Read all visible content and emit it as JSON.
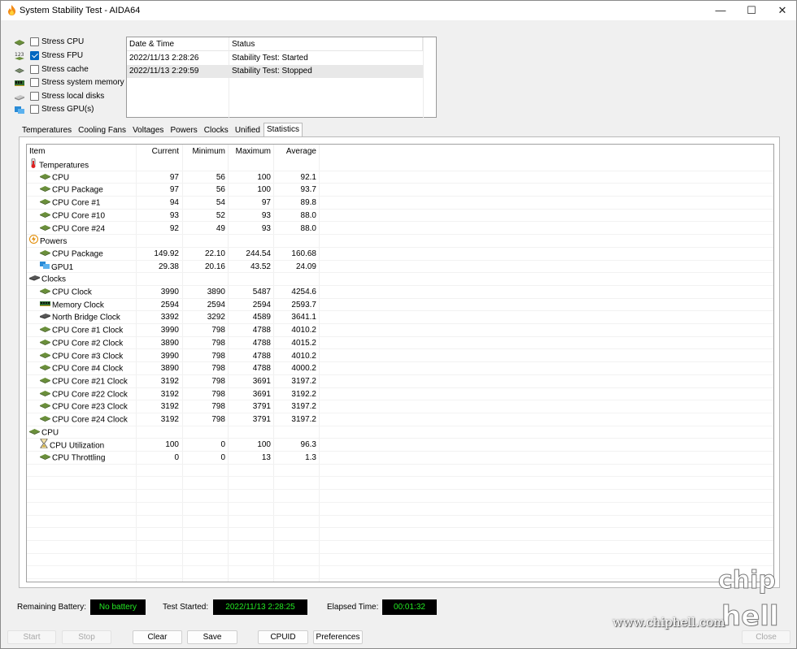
{
  "window": {
    "title": "System Stability Test - AIDA64",
    "min_glyph": "—",
    "max_glyph": "☐",
    "close_glyph": "✕"
  },
  "stress_options": [
    {
      "label": "Stress CPU",
      "checked": false,
      "icon": "cpu-chip-icon"
    },
    {
      "label": "Stress FPU",
      "checked": true,
      "icon": "fpu-123-icon"
    },
    {
      "label": "Stress cache",
      "checked": false,
      "icon": "cache-chip-icon"
    },
    {
      "label": "Stress system memory",
      "checked": false,
      "icon": "memory-module-icon"
    },
    {
      "label": "Stress local disks",
      "checked": false,
      "icon": "disk-drive-icon"
    },
    {
      "label": "Stress GPU(s)",
      "checked": false,
      "icon": "gpu-card-icon"
    }
  ],
  "log": {
    "headers": [
      "Date & Time",
      "Status"
    ],
    "rows": [
      [
        "2022/11/13 2:28:26",
        "Stability Test: Started"
      ],
      [
        "2022/11/13 2:29:59",
        "Stability Test: Stopped"
      ]
    ]
  },
  "tabs": [
    "Temperatures",
    "Cooling Fans",
    "Voltages",
    "Powers",
    "Clocks",
    "Unified",
    "Statistics"
  ],
  "active_tab": "Statistics",
  "stats": {
    "headers": [
      "Item",
      "Current",
      "Minimum",
      "Maximum",
      "Average"
    ],
    "rows": [
      {
        "group": true,
        "name": "Temperatures",
        "icon": "thermometer-icon"
      },
      {
        "name": "CPU",
        "icon": "cpu-chip-icon",
        "vals": [
          "97",
          "56",
          "100",
          "92.1"
        ]
      },
      {
        "name": "CPU Package",
        "icon": "cpu-chip-icon",
        "vals": [
          "97",
          "56",
          "100",
          "93.7"
        ]
      },
      {
        "name": "CPU Core #1",
        "icon": "cpu-chip-icon",
        "vals": [
          "94",
          "54",
          "97",
          "89.8"
        ]
      },
      {
        "name": "CPU Core #10",
        "icon": "cpu-chip-icon",
        "vals": [
          "93",
          "52",
          "93",
          "88.0"
        ]
      },
      {
        "name": "CPU Core #24",
        "icon": "cpu-chip-icon",
        "vals": [
          "92",
          "49",
          "93",
          "88.0"
        ]
      },
      {
        "group": true,
        "name": "Powers",
        "icon": "power-bolt-icon"
      },
      {
        "name": "CPU Package",
        "icon": "cpu-chip-icon",
        "vals": [
          "149.92",
          "22.10",
          "244.54",
          "160.68"
        ]
      },
      {
        "name": "GPU1",
        "icon": "gpu-card-icon",
        "vals": [
          "29.38",
          "20.16",
          "43.52",
          "24.09"
        ]
      },
      {
        "group": true,
        "name": "Clocks",
        "icon": "clock-board-icon"
      },
      {
        "name": "CPU Clock",
        "icon": "cpu-chip-icon",
        "vals": [
          "3990",
          "3890",
          "5487",
          "4254.6"
        ]
      },
      {
        "name": "Memory Clock",
        "icon": "memory-module-icon",
        "vals": [
          "2594",
          "2594",
          "2594",
          "2593.7"
        ]
      },
      {
        "name": "North Bridge Clock",
        "icon": "north-bridge-icon",
        "vals": [
          "3392",
          "3292",
          "4589",
          "3641.1"
        ]
      },
      {
        "name": "CPU Core #1 Clock",
        "icon": "cpu-chip-icon",
        "vals": [
          "3990",
          "798",
          "4788",
          "4010.2"
        ]
      },
      {
        "name": "CPU Core #2 Clock",
        "icon": "cpu-chip-icon",
        "vals": [
          "3890",
          "798",
          "4788",
          "4015.2"
        ]
      },
      {
        "name": "CPU Core #3 Clock",
        "icon": "cpu-chip-icon",
        "vals": [
          "3990",
          "798",
          "4788",
          "4010.2"
        ]
      },
      {
        "name": "CPU Core #4 Clock",
        "icon": "cpu-chip-icon",
        "vals": [
          "3890",
          "798",
          "4788",
          "4000.2"
        ]
      },
      {
        "name": "CPU Core #21 Clock",
        "icon": "cpu-chip-icon",
        "vals": [
          "3192",
          "798",
          "3691",
          "3197.2"
        ]
      },
      {
        "name": "CPU Core #22 Clock",
        "icon": "cpu-chip-icon",
        "vals": [
          "3192",
          "798",
          "3691",
          "3192.2"
        ]
      },
      {
        "name": "CPU Core #23 Clock",
        "icon": "cpu-chip-icon",
        "vals": [
          "3192",
          "798",
          "3791",
          "3197.2"
        ]
      },
      {
        "name": "CPU Core #24 Clock",
        "icon": "cpu-chip-icon",
        "vals": [
          "3192",
          "798",
          "3791",
          "3197.2"
        ]
      },
      {
        "group": true,
        "name": "CPU",
        "icon": "cpu-chip-icon"
      },
      {
        "name": "CPU Utilization",
        "icon": "hourglass-icon",
        "vals": [
          "100",
          "0",
          "100",
          "96.3"
        ]
      },
      {
        "name": "CPU Throttling",
        "icon": "cpu-chip-icon",
        "vals": [
          "0",
          "0",
          "13",
          "1.3"
        ]
      }
    ]
  },
  "status": {
    "battery_label": "Remaining Battery:",
    "battery_value": "No battery",
    "started_label": "Test Started:",
    "started_value": "2022/11/13 2:28:25",
    "elapsed_label": "Elapsed Time:",
    "elapsed_value": "00:01:32"
  },
  "buttons": {
    "start": "Start",
    "stop": "Stop",
    "clear": "Clear",
    "save": "Save",
    "cpuid": "CPUID",
    "preferences": "Preferences",
    "close": "Close"
  },
  "watermark": {
    "url": "www.chiphell.com",
    "logo_top": "chip",
    "logo_bottom": "hell"
  },
  "colors": {
    "status_text": "#23e823",
    "checkbox_accent": "#0067c0"
  }
}
